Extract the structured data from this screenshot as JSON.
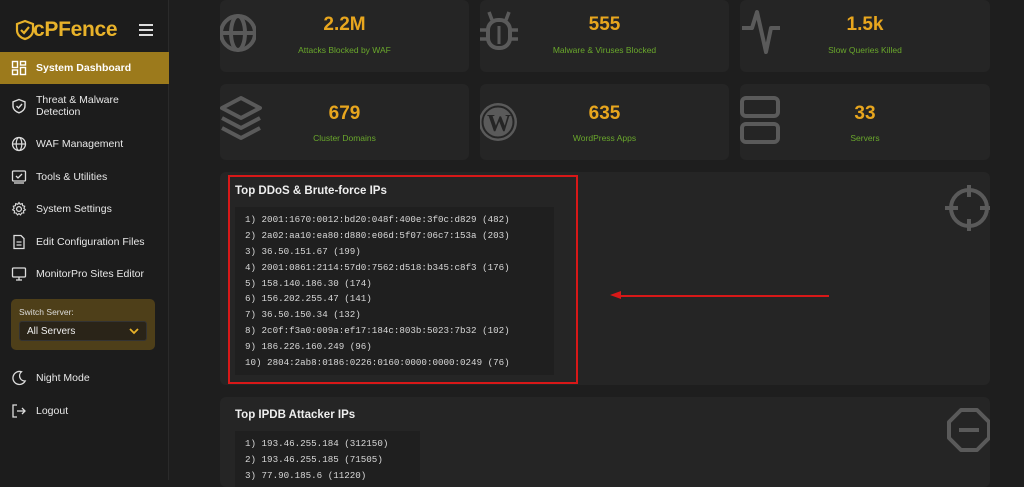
{
  "brand": {
    "logo_text": "cPFence"
  },
  "nav": {
    "items": [
      {
        "label": "System Dashboard",
        "icon": "dashboard-icon"
      },
      {
        "label": "Threat & Malware Detection",
        "icon": "shield-icon"
      },
      {
        "label": "WAF Management",
        "icon": "globe-icon"
      },
      {
        "label": "Tools & Utilities",
        "icon": "checklist-icon"
      },
      {
        "label": "System Settings",
        "icon": "gear-icon"
      },
      {
        "label": "Edit Configuration Files",
        "icon": "file-icon"
      },
      {
        "label": "MonitorPro Sites Editor",
        "icon": "monitor-icon"
      }
    ],
    "bottom": [
      {
        "label": "Night Mode",
        "icon": "moon-icon"
      },
      {
        "label": "Logout",
        "icon": "logout-icon"
      }
    ]
  },
  "server_switch": {
    "label": "Switch Server:",
    "selected": "All Servers"
  },
  "stats": [
    {
      "value": "2.2M",
      "label": "Attacks Blocked by WAF",
      "icon": "globe-icon"
    },
    {
      "value": "555",
      "label": "Malware & Viruses Blocked",
      "icon": "bug-icon"
    },
    {
      "value": "1.5k",
      "label": "Slow Queries Killed",
      "icon": "pulse-icon"
    },
    {
      "value": "679",
      "label": "Cluster Domains",
      "icon": "layers-icon"
    },
    {
      "value": "635",
      "label": "WordPress Apps",
      "icon": "wordpress-icon"
    },
    {
      "value": "33",
      "label": "Servers",
      "icon": "server-icon"
    }
  ],
  "ddos": {
    "title": "Top DDoS & Brute-force IPs",
    "items": [
      "1) 2001:1670:0012:bd20:048f:400e:3f0c:d829 (482)",
      "2) 2a02:aa10:ea80:d880:e06d:5f07:06c7:153a (203)",
      "3) 36.50.151.67 (199)",
      "4) 2001:0861:2114:57d0:7562:d518:b345:c8f3 (176)",
      "5) 158.140.186.30 (174)",
      "6) 156.202.255.47 (141)",
      "7) 36.50.150.34 (132)",
      "8) 2c0f:f3a0:009a:ef17:184c:803b:5023:7b32 (102)",
      "9) 186.226.160.249 (96)",
      "10) 2804:2ab8:0186:0226:0160:0000:0000:0249 (76)"
    ]
  },
  "ipdb": {
    "title": "Top IPDB Attacker IPs",
    "items": [
      "1) 193.46.255.184 (312150)",
      "2) 193.46.255.185 (71505)",
      "3) 77.90.185.6 (11220)"
    ]
  },
  "colors": {
    "accent": "#9c7a1c",
    "stat_value": "#e8a61e",
    "stat_label": "#6aa82c",
    "highlight": "#d81818"
  }
}
